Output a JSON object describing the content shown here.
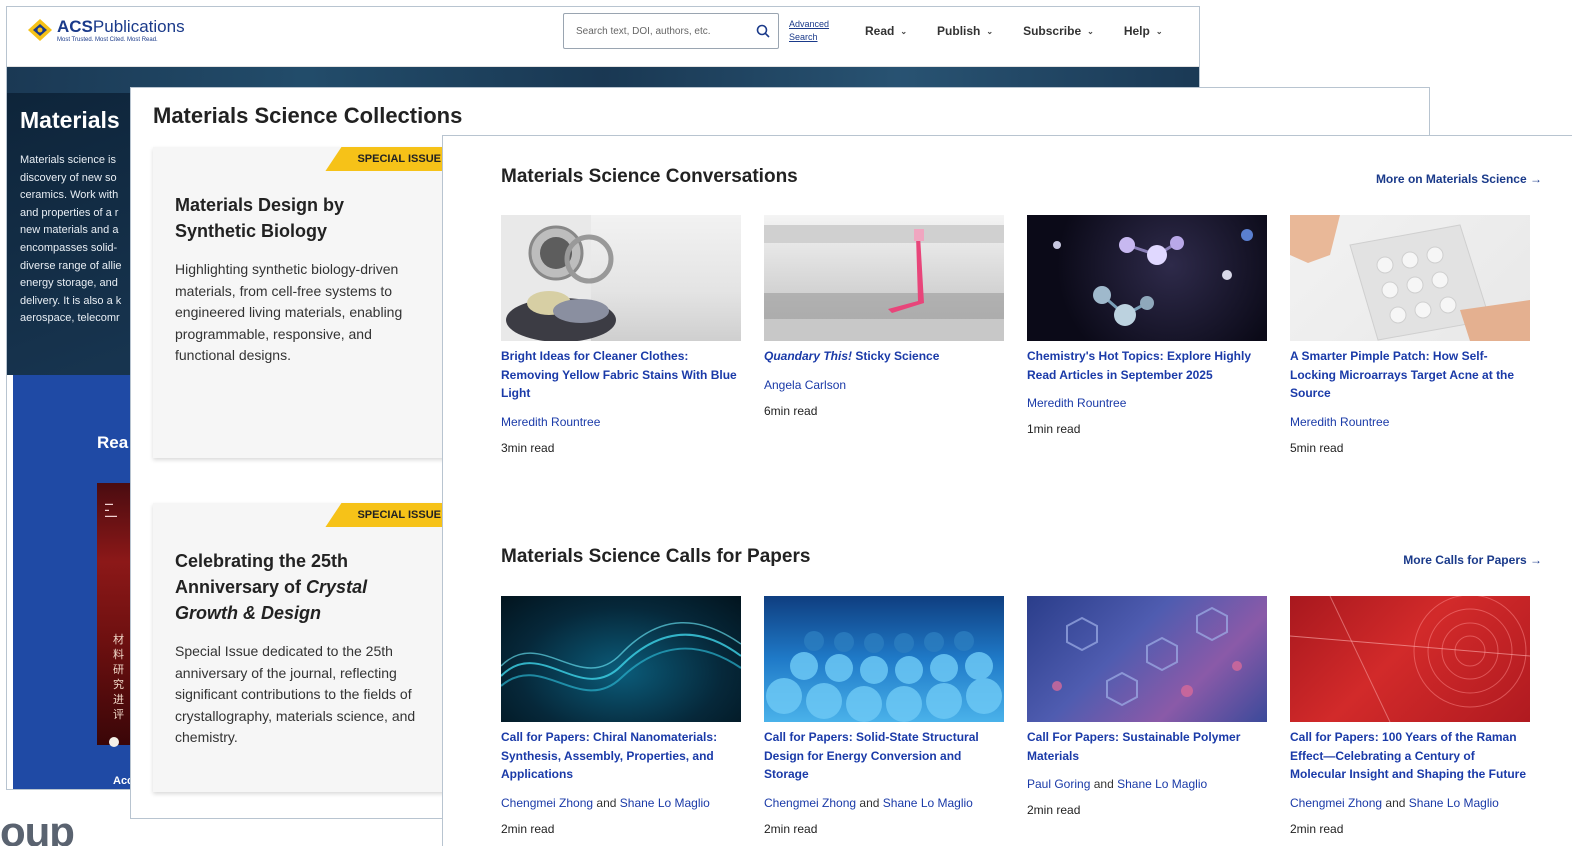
{
  "header": {
    "logo_name_bold": "ACS",
    "logo_name": "Publications",
    "logo_tagline": "Most Trusted. Most Cited. Most Read.",
    "search_placeholder": "Search text, DOI, authors, etc.",
    "advanced_search": "Advanced Search",
    "nav": [
      {
        "label": "Read"
      },
      {
        "label": "Publish"
      },
      {
        "label": "Subscribe"
      },
      {
        "label": "Help"
      }
    ]
  },
  "hero": {
    "title": "Materials",
    "lines": [
      "Materials science is",
      "discovery of new so",
      "ceramics. Work with",
      "and properties of a r",
      "new materials and a",
      "encompasses solid-",
      "diverse range of allie",
      "energy storage, and",
      "delivery. It is also a k",
      "aerospace, telecomr"
    ]
  },
  "read_band": {
    "label": "Rea",
    "access_label": "Acc"
  },
  "collections": {
    "title": "Materials Science Collections",
    "cards": [
      {
        "badge": "SPECIAL ISSUE",
        "heading": "Materials Design by Synthetic Biology",
        "body": "Highlighting synthetic biology-driven materials, from cell-free systems to engineered living materials, enabling programmable, responsive, and functional designs."
      },
      {
        "badge": "SPECIAL ISSUE",
        "heading_1": "Celebrating the 25th Anniversary of ",
        "heading_italic": "Crystal Growth & Design",
        "body": "Special Issue dedicated to the 25th anniversary of the journal, reflecting significant contributions to the fields of crystallography, materials science, and chemistry."
      }
    ]
  },
  "conversations": {
    "title": "Materials Science Conversations",
    "more": "More on Materials Science →",
    "items": [
      {
        "title": "Bright Ideas for Cleaner Clothes: Removing Yellow Fabric Stains With Blue Light",
        "author": "Meredith Rountree",
        "read": "3min read"
      },
      {
        "title_italic": "Quandary This!",
        "title_rest": " Sticky Science",
        "author": "Angela Carlson",
        "read": "6min read"
      },
      {
        "title": "Chemistry's Hot Topics: Explore Highly Read Articles in September 2025",
        "author": "Meredith Rountree",
        "read": "1min read"
      },
      {
        "title": "A Smarter Pimple Patch: How Self-Locking Microarrays Target Acne at the Source",
        "author": "Meredith Rountree",
        "read": "5min read"
      }
    ]
  },
  "calls": {
    "title": "Materials Science Calls for Papers",
    "more": "More Calls for Papers →",
    "and": "and",
    "items": [
      {
        "title": "Call for Papers: Chiral Nanomaterials: Synthesis, Assembly, Properties, and Applications",
        "author_1": "Chengmei Zhong",
        "author_2": "Shane Lo Maglio",
        "read": "2min read"
      },
      {
        "title": "Call for Papers: Solid-State Structural Design for Energy Conversion and Storage",
        "author_1": "Chengmei Zhong",
        "author_2": "Shane Lo Maglio",
        "read": "2min read"
      },
      {
        "title": "Call For Papers: Sustainable Polymer Materials",
        "author_1": "Paul Goring",
        "author_2": "Shane Lo Maglio",
        "read": "2min read"
      },
      {
        "title": "Call for Papers: 100 Years of the Raman Effect—Celebrating a Century of Molecular Insight and Shaping the Future",
        "author_1": "Chengmei Zhong",
        "author_2": "Shane Lo Maglio",
        "read": "2min read"
      }
    ]
  },
  "footer_fragment": "oup",
  "colors": {
    "brand_blue": "#1a3a8a",
    "link_blue": "#1a3aa8",
    "badge_yellow": "#f6c218",
    "hero_navy": "#122c44",
    "read_band_blue": "#1f4aa5"
  }
}
